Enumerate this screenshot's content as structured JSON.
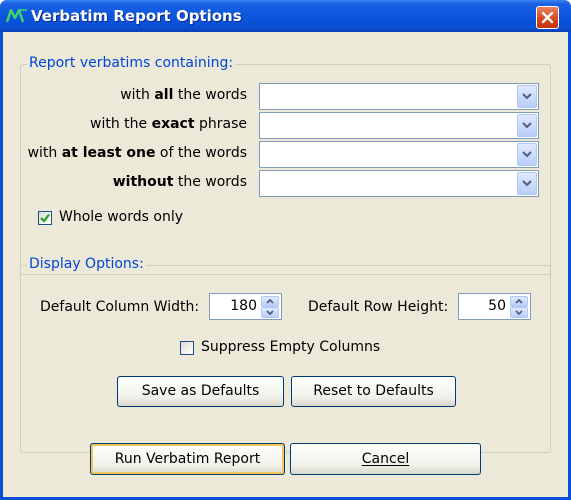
{
  "window": {
    "title": "Verbatim Report Options",
    "icon": "app-logo-icon",
    "close_icon": "close-icon"
  },
  "report_group": {
    "legend": "Report verbatims containing:",
    "rows": [
      {
        "pre": "with ",
        "bold": "all",
        "post": " the words",
        "value": ""
      },
      {
        "pre": "with the ",
        "bold": "exact",
        "post": " phrase",
        "value": ""
      },
      {
        "pre": "with ",
        "bold": "at least one",
        "post": " of the words",
        "value": ""
      },
      {
        "pre": "",
        "bold": "without",
        "post": " the words",
        "value": ""
      }
    ],
    "whole_words_label": "Whole words only",
    "whole_words_checked": true
  },
  "display_group": {
    "legend": "Display Options:",
    "column_width_label": "Default Column Width:",
    "column_width_value": "180",
    "row_height_label": "Default Row Height:",
    "row_height_value": "50",
    "suppress_label": "Suppress Empty Columns",
    "suppress_checked": false,
    "save_defaults_label": "Save as Defaults",
    "reset_defaults_label": "Reset to Defaults"
  },
  "footer": {
    "run_label": "Run Verbatim Report",
    "cancel_label": "Cancel"
  },
  "colors": {
    "titlebar": "#0a4fd8",
    "legend_text": "#0046d5",
    "dialog_bg": "#ece9d8",
    "checkmark": "#21a121"
  }
}
